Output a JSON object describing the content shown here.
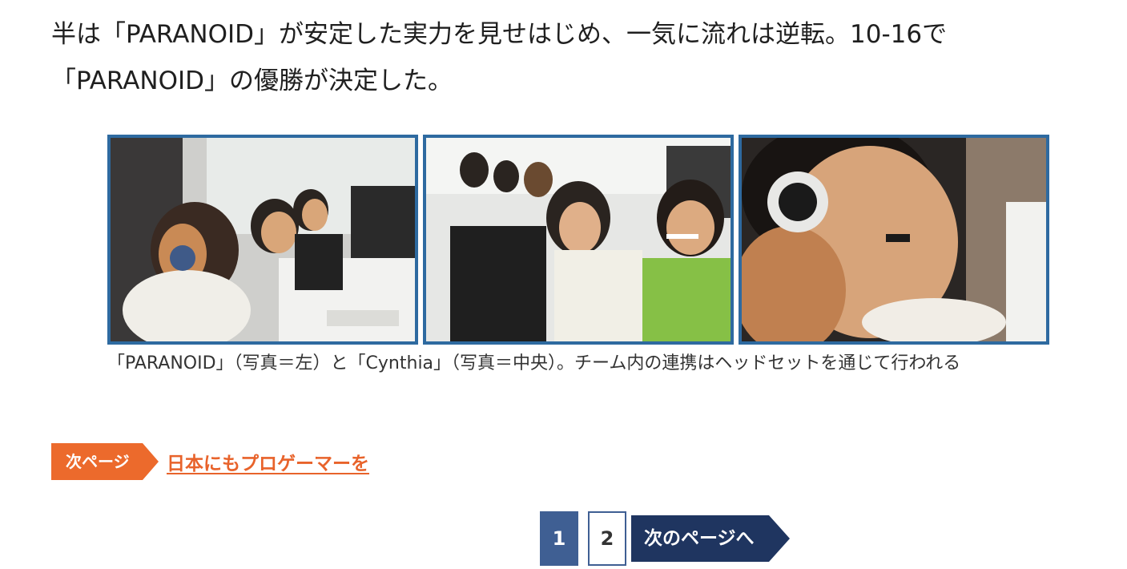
{
  "article": {
    "paragraph": "半は「PARANOID」が安定した実力を見せはじめ、一気に流れは逆転。10-16で「PARANOID」の優勝が決定した。"
  },
  "photos": {
    "caption": "「PARANOID」（写真＝左）と「Cynthia」（写真＝中央）。チーム内の連携はヘッドセットを通じて行われる"
  },
  "next_section": {
    "badge_label": "次ページ",
    "link_text": "日本にもプロゲーマーを",
    "badge_color": "#ec6a2c",
    "link_color": "#e8632b"
  },
  "pagination": {
    "pages": [
      "1",
      "2"
    ],
    "current_page": "1",
    "next_label": "次のページへ",
    "accent_color": "#3f5f93",
    "next_button_color": "#1f3560"
  }
}
